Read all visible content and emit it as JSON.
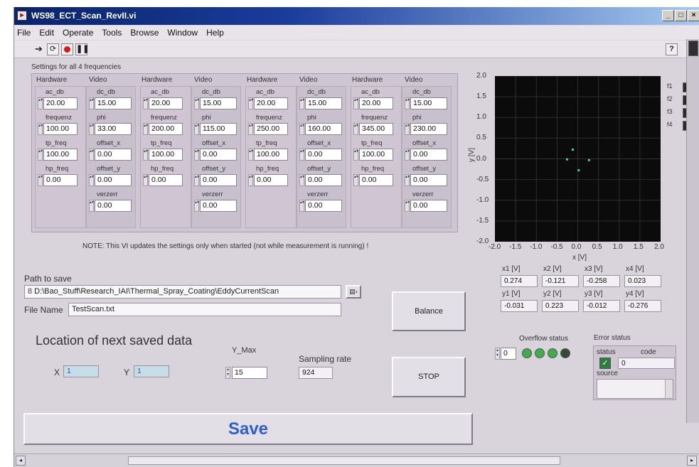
{
  "window": {
    "title": "WS98_ECT_Scan_RevII.vi",
    "app_icon": "labview-vi-icon",
    "buttons": [
      "_",
      "□",
      "×"
    ]
  },
  "menu": [
    "File",
    "Edit",
    "Operate",
    "Tools",
    "Browse",
    "Window",
    "Help"
  ],
  "toolbar": {
    "icons": [
      "run-arrow-icon",
      "run-continuously-icon",
      "abort-stop-icon",
      "pause-icon"
    ],
    "help_icon": "?"
  },
  "settings": {
    "group_label": "Settings for all 4 frequencies",
    "hardware_header": "Hardware",
    "video_header": "Video",
    "hw_labels": {
      "ac_db": "ac_db",
      "freq": "frequenz",
      "tp": "tp_freq",
      "hp": "hp_freq"
    },
    "vd_labels": {
      "dc_db": "dc_db",
      "phi": "phi",
      "ox": "offset_x",
      "oy": "offset_y",
      "v": "verzerr"
    },
    "frequencies": [
      {
        "ac_db": "20.00",
        "frequenz": "100.00",
        "tp_freq": "100.00",
        "hp_freq": "0.00",
        "dc_db": "15.00",
        "phi": "33.00",
        "offset_x": "0.00",
        "offset_y": "0.00",
        "verzerr": "0.00"
      },
      {
        "ac_db": "20.00",
        "frequenz": "200.00",
        "tp_freq": "100.00",
        "hp_freq": "0.00",
        "dc_db": "15.00",
        "phi": "115.00",
        "offset_x": "0.00",
        "offset_y": "0.00",
        "verzerr": "0.00"
      },
      {
        "ac_db": "20.00",
        "frequenz": "250.00",
        "tp_freq": "100.00",
        "hp_freq": "0.00",
        "dc_db": "15.00",
        "phi": "160.00",
        "offset_x": "0.00",
        "offset_y": "0.00",
        "verzerr": "0.00"
      },
      {
        "ac_db": "20.00",
        "frequenz": "345.00",
        "tp_freq": "100.00",
        "hp_freq": "0.00",
        "dc_db": "15.00",
        "phi": "230.00",
        "offset_x": "0.00",
        "offset_y": "0.00",
        "verzerr": "0.00"
      }
    ]
  },
  "note": "NOTE: This VI updates the settings only when started (not while measurement is running) !",
  "path": {
    "label": "Path to save",
    "value": "D:\\Bao_Stuff\\Research_IAI\\Thermal_Spray_Coating\\EddyCurrentScan",
    "prefix": "8",
    "browse_icon": "browse-folder-icon"
  },
  "filename": {
    "label": "File Name",
    "value": "TestScan.txt"
  },
  "location": {
    "title": "Location of next saved data",
    "x_label": "X",
    "x_value": "1",
    "y_label": "Y",
    "y_value": "1"
  },
  "ymax": {
    "label": "Y_Max",
    "value": "15"
  },
  "sampling": {
    "label": "Sampling rate",
    "value": "924"
  },
  "buttons": {
    "balance": "Balance",
    "stop": "STOP",
    "save": "Save"
  },
  "graph": {
    "xlabel": "x [V]",
    "ylabel": "y [V]",
    "yticks": [
      "2.0",
      "1.5",
      "1.0",
      "0.5",
      "0.0",
      "-0.5",
      "-1.0",
      "-1.5",
      "-2.0"
    ],
    "xticks": [
      "-2.0",
      "-1.5",
      "-1.0",
      "-0.5",
      "0.0",
      "0.5",
      "1.0",
      "1.5",
      "2.0"
    ],
    "legend": [
      "f1",
      "f2",
      "f3",
      "f4"
    ],
    "trace_color": "#3fd38c"
  },
  "chart_data": {
    "type": "scatter",
    "xlabel": "x [V]",
    "ylabel": "y [V]",
    "xlim": [
      -2.0,
      2.0
    ],
    "ylim": [
      -2.0,
      2.0
    ],
    "grid": true,
    "series": [
      {
        "name": "f1",
        "x": [
          0.274
        ],
        "y": [
          -0.031
        ]
      },
      {
        "name": "f2",
        "x": [
          -0.121
        ],
        "y": [
          0.223
        ]
      },
      {
        "name": "f3",
        "x": [
          -0.258
        ],
        "y": [
          -0.012
        ]
      },
      {
        "name": "f4",
        "x": [
          0.023
        ],
        "y": [
          -0.276
        ]
      }
    ]
  },
  "readouts": {
    "x_labels": [
      "x1 [V]",
      "x2 [V]",
      "x3 [V]",
      "x4 [V]"
    ],
    "x_values": [
      "0.274",
      "-0.121",
      "-0.258",
      "0.023"
    ],
    "y_labels": [
      "y1 [V]",
      "y2 [V]",
      "y3 [V]",
      "y4 [V]"
    ],
    "y_values": [
      "-0.031",
      "0.223",
      "-0.012",
      "-0.276"
    ]
  },
  "overflow": {
    "label": "Overflow status",
    "value": "0",
    "led_on": "#3fae4a",
    "led_off": "#2f4f33"
  },
  "error": {
    "label": "Error status",
    "status_label": "status",
    "code_label": "code",
    "code_value": "0",
    "source_label": "source",
    "status_check": "✓"
  }
}
